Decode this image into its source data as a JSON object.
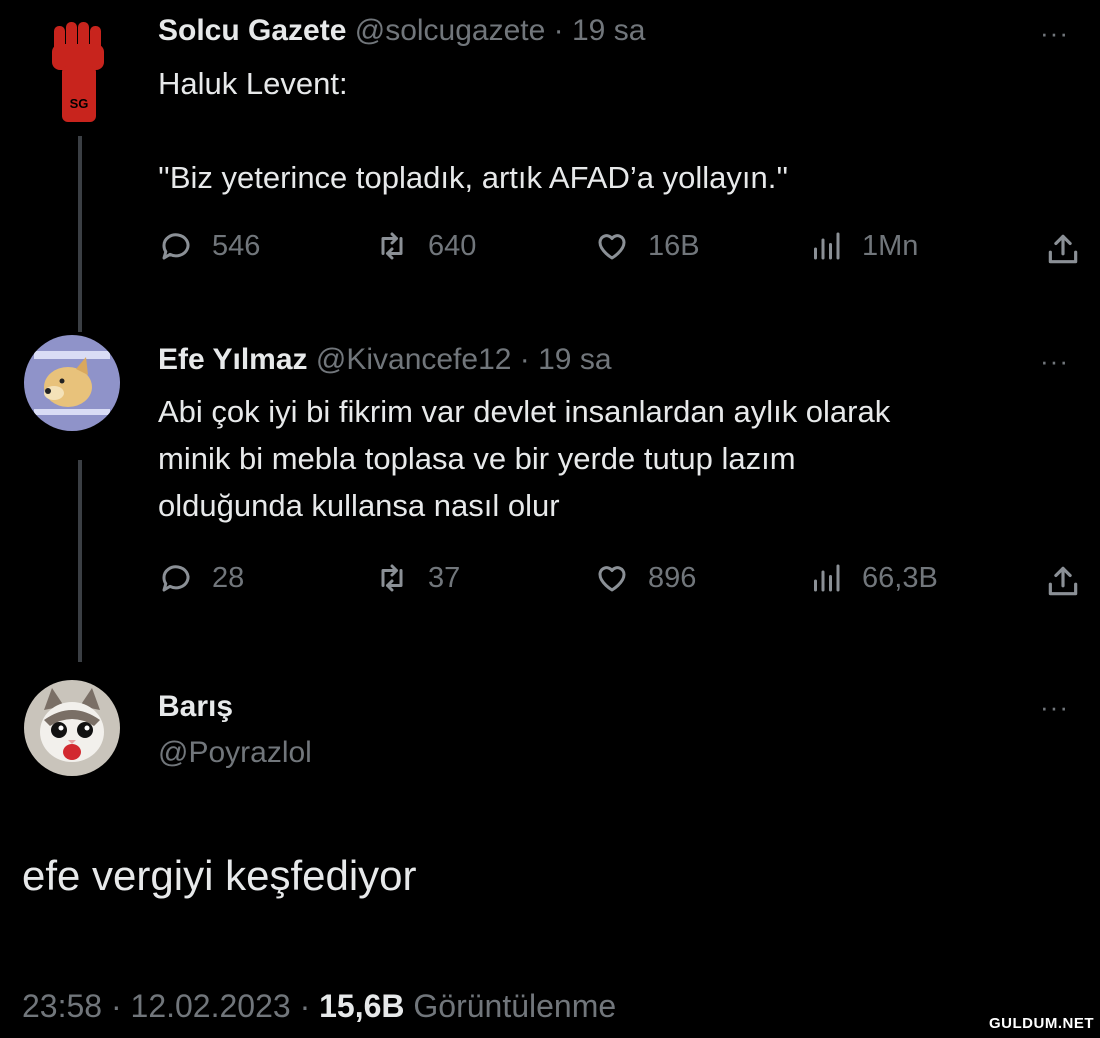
{
  "tweet1": {
    "name": "Solcu Gazete",
    "handle": "@solcugazete",
    "sep": " · ",
    "time": "19 sa",
    "more": "···",
    "text": "Haluk Levent:\n\n''Biz yeterince topladık, artık AFAD’a yollayın.''",
    "replies": "546",
    "retweets": "640",
    "likes": "16B",
    "views": "1Mn",
    "avatar_text": "SG"
  },
  "tweet2": {
    "name": "Efe Yılmaz",
    "handle": "@Kivancefe12",
    "sep": " · ",
    "time": "19 sa",
    "more": "···",
    "text": "Abi çok iyi bi fikrim var devlet insanlardan aylık olarak\nminik bi mebla toplasa ve bir yerde tutup lazım\nolduğunda kullansa nasıl olur",
    "replies": "28",
    "retweets": "37",
    "likes": "896",
    "views": "66,3B"
  },
  "tweet3": {
    "name": "Barış",
    "handle": "@Poyrazlol",
    "more": "···",
    "text": "efe vergiyi keşfediyor"
  },
  "footer": {
    "time": "23:58",
    "sep1": " · ",
    "date": "12.02.2023",
    "sep2": " · ",
    "views": "15,6B",
    "views_label": " Görüntülenme"
  },
  "watermark": "GULDUM.NET",
  "colors": {
    "background": "#000000",
    "text": "#e7e9ea",
    "muted": "#71767b",
    "fist": "#c8241d"
  },
  "icons": [
    "reply-icon",
    "retweet-icon",
    "like-icon",
    "views-icon",
    "share-icon",
    "more-icon"
  ]
}
